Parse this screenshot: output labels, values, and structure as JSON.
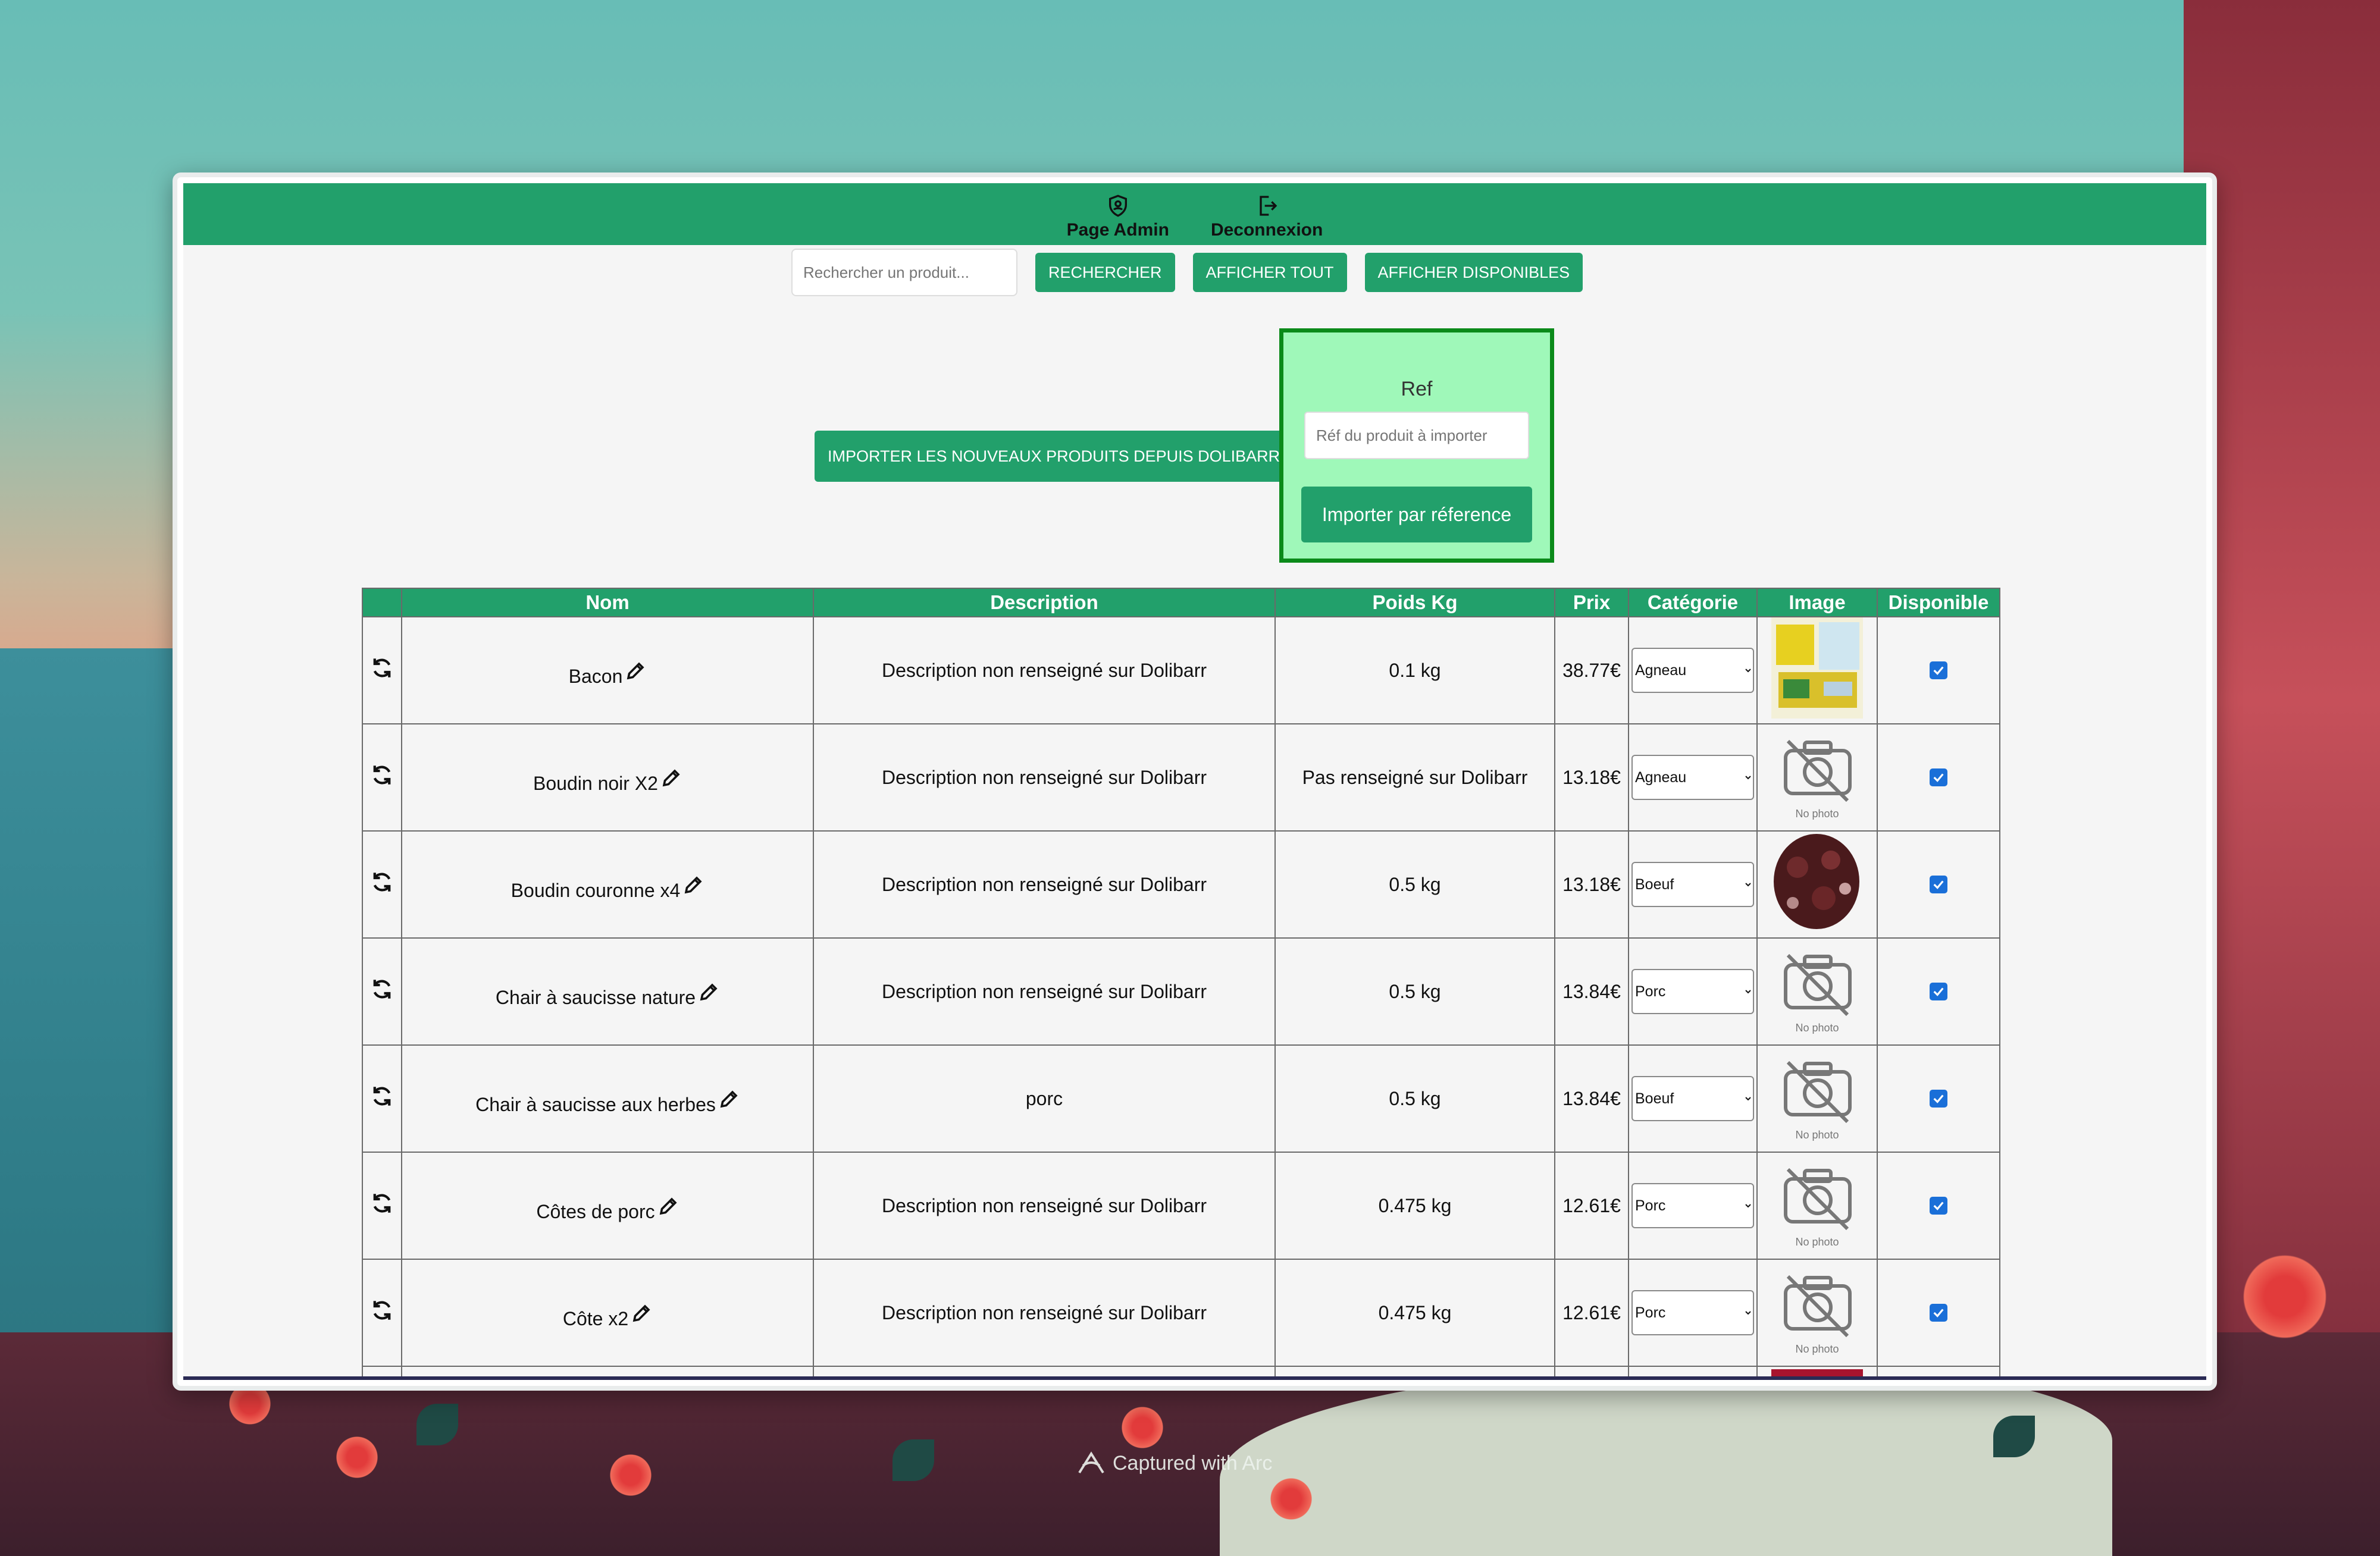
{
  "nav": {
    "admin_label": "Page Admin",
    "logout_label": "Deconnexion"
  },
  "search": {
    "placeholder": "Rechercher un produit...",
    "search_label": "RECHERCHER",
    "show_all_label": "AFFICHER TOUT",
    "show_available_label": "AFFICHER DISPONIBLES"
  },
  "import": {
    "all_label": "IMPORTER LES NOUVEAUX PRODUITS DEPUIS DOLIBARR",
    "ref_label": "Ref",
    "ref_placeholder": "Réf du produit à importer",
    "ref_button": "Importer par réference"
  },
  "table": {
    "headers": {
      "nom": "Nom",
      "description": "Description",
      "poids": "Poids Kg",
      "prix": "Prix",
      "categorie": "Catégorie",
      "image": "Image",
      "disponible": "Disponible"
    },
    "no_photo_text": "No photo",
    "rows": [
      {
        "nom": "Bacon",
        "description": "Description non renseigné sur Dolibarr",
        "poids": "0.1 kg",
        "prix": "38.77€",
        "categorie": "Agneau",
        "image": "photo-bacon",
        "disponible": true
      },
      {
        "nom": "Boudin noir X2",
        "description": "Description non renseigné sur Dolibarr",
        "poids": "Pas renseigné sur Dolibarr",
        "prix": "13.18€",
        "categorie": "Agneau",
        "image": "no-photo",
        "disponible": true
      },
      {
        "nom": "Boudin couronne x4",
        "description": "Description non renseigné sur Dolibarr",
        "poids": "0.5 kg",
        "prix": "13.18€",
        "categorie": "Boeuf",
        "image": "photo-boudin",
        "disponible": true
      },
      {
        "nom": "Chair à saucisse nature",
        "description": "Description non renseigné sur Dolibarr",
        "poids": "0.5 kg",
        "prix": "13.84€",
        "categorie": "Porc",
        "image": "no-photo",
        "disponible": true
      },
      {
        "nom": "Chair à saucisse aux herbes",
        "description": "porc",
        "poids": "0.5 kg",
        "prix": "13.84€",
        "categorie": "Boeuf",
        "image": "no-photo",
        "disponible": true
      },
      {
        "nom": "Côtes de porc",
        "description": "Description non renseigné sur Dolibarr",
        "poids": "0.475 kg",
        "prix": "12.61€",
        "categorie": "Porc",
        "image": "no-photo",
        "disponible": true
      },
      {
        "nom": "Côte x2",
        "description": "Description non renseigné sur Dolibarr",
        "poids": "0.475 kg",
        "prix": "12.61€",
        "categorie": "Porc",
        "image": "no-photo",
        "disponible": true
      }
    ]
  },
  "watermark": "Captured with Arc",
  "colors": {
    "accent": "#22a06b",
    "ref_box_bg": "#9ff8b9",
    "ref_box_border": "#0b8a1a"
  }
}
